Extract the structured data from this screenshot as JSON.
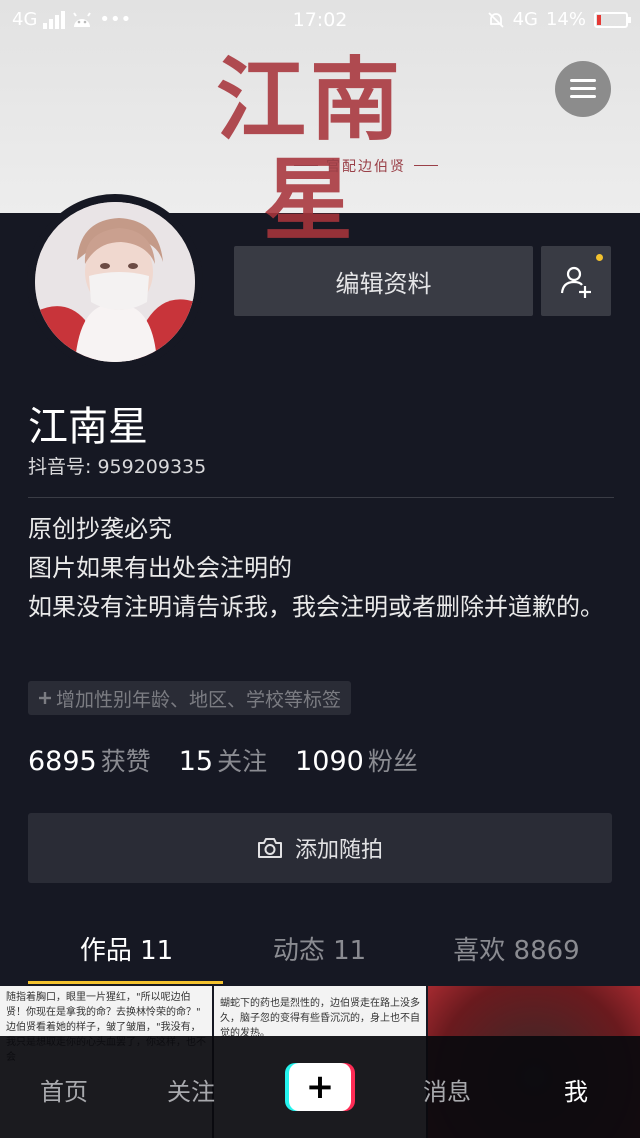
{
  "status_bar": {
    "network_left": "4G",
    "more": "•••",
    "time": "17:02",
    "network_right": "4G",
    "battery": "14%",
    "battery_level_percent": 14
  },
  "banner": {
    "logo_title": "江南星",
    "logo_subtitle": "官配边伯贤"
  },
  "profile": {
    "name": "江南星",
    "douyin_id": "抖音号: 959209335",
    "edit_label": "编辑资料",
    "bio": [
      "原创抄袭必究",
      "图片如果有出处会注明的",
      "如果没有注明请告诉我，我会注明或者删除并道歉的。"
    ],
    "tag_add": "增加性别年龄、地区、学校等标签",
    "stats": [
      {
        "num": "6895",
        "label": "获赞"
      },
      {
        "num": "15",
        "label": "关注"
      },
      {
        "num": "1090",
        "label": "粉丝"
      }
    ],
    "snap_label": "添加随拍"
  },
  "tabs": [
    {
      "label": "作品 11"
    },
    {
      "label": "动态 11"
    },
    {
      "label": "喜欢 8869"
    }
  ],
  "grid": [
    {
      "text": "随指着胸口，眼里一片猩红，\"所以呢边伯贤！你现在是拿我的命？去换林怜荣的命？\" 边伯贤看着她的样子，皱了皱眉，\"我没有，我只是想取走你的心头血罢了，你这样，也不会"
    },
    {
      "text": "蝴蛇下的药也是烈性的，边伯贤走在路上没多久，脑子忽的变得有些昏沉沉的，身上也不自觉的发热。"
    },
    {
      "text": ""
    }
  ],
  "bottom_nav": [
    {
      "label": "首页"
    },
    {
      "label": "关注"
    },
    {
      "label": "+"
    },
    {
      "label": "消息"
    },
    {
      "label": "我"
    }
  ],
  "colors": {
    "background": "#161823",
    "accent_yellow": "#f2c12e",
    "button_bg": "#393b44",
    "plus_cyan": "#25f4ee",
    "plus_red": "#fe2c55"
  }
}
